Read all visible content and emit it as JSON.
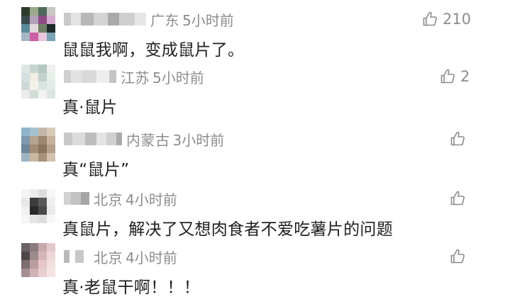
{
  "comments": [
    {
      "location": "广东",
      "time": "5小时前",
      "text": "鼠鼠我啊，变成鼠片了。",
      "likes": "210",
      "avatar_colors": [
        "#2d3b2a",
        "#9aa88b",
        "#4d6b5a",
        "#c9c7c2",
        "#3a4a4e",
        "#b2a1b8",
        "#8f4a86",
        "#d6a9cf",
        "#5c8a9b",
        "#e2d8dd",
        "#6f7f66",
        "#1e2a2a",
        "#a7b6c2",
        "#cd5fa4",
        "#eac6dc",
        "#7aa3b6"
      ]
    },
    {
      "location": "江苏",
      "time": "5小时前",
      "text": "真·鼠片",
      "likes": "2",
      "avatar_colors": [
        "#dfe7e4",
        "#c8d6d2",
        "#b5c9c4",
        "#eef0ef",
        "#d6dfe1",
        "#f1ece4",
        "#c2d3cd",
        "#e7efe9",
        "#cfd9d6",
        "#f3f1ea",
        "#dae4e1",
        "#e5ebe8",
        "#eaedec",
        "#d2ddd8",
        "#f0f2ef",
        "#dce5e1"
      ]
    },
    {
      "location": "内蒙古",
      "time": "3小时前",
      "text": "真“鼠片”",
      "likes": "",
      "avatar_colors": [
        "#8fb3c9",
        "#a6c1d2",
        "#c4b8a9",
        "#d9cbb8",
        "#7f98ad",
        "#b8a38e",
        "#9c8671",
        "#c7b29c",
        "#6e869a",
        "#a38c76",
        "#8b735f",
        "#b59f88",
        "#9eb4c3",
        "#c9b7a2",
        "#a8927c",
        "#d2c2ae"
      ]
    },
    {
      "location": "北京",
      "time": "4小时前",
      "text": "真鼠片，解决了又想肉食者不爱吃薯片的问题",
      "likes": "",
      "avatar_colors": [
        "#f4f4f4",
        "#ececec",
        "#dedede",
        "#f7f7f7",
        "#e8e8e8",
        "#3c3c3c",
        "#5a5a5a",
        "#efefef",
        "#f0f0f0",
        "#2a2a2a",
        "#4a4a4a",
        "#eaeaea",
        "#f6f6f6",
        "#e4e4e4",
        "#dcdcdc",
        "#f8f8f8"
      ]
    },
    {
      "location": "北京",
      "time": "4小时前",
      "text": "真·老鼠干啊！！！",
      "likes": "",
      "avatar_colors": [
        "#6a6265",
        "#8a7b7e",
        "#c9a9ad",
        "#e2c9cb",
        "#4e4649",
        "#9d8a8c",
        "#d7b6b9",
        "#eed8d9",
        "#7b6d70",
        "#b89c9f",
        "#e6c6c8",
        "#f2dede",
        "#a48e91",
        "#d0b2b4",
        "#e9cfd1",
        "#f5e4e4"
      ]
    }
  ],
  "like_icon": "thumbs-up-icon"
}
